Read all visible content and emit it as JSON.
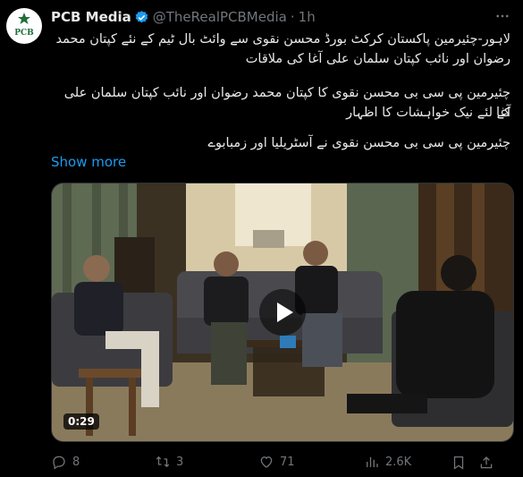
{
  "tweet": {
    "display_name": "PCB Media",
    "handle": "@TheRealPCBMedia",
    "separator": "·",
    "time": "1h",
    "avatar_text": "PCB",
    "more_icon": "more-dots-icon",
    "text_lines": [
      "لاہور-چئیرمین پاکستان کرکٹ بورڈ محسن نقوی سے وائٹ بال ٹیم کے نئے کپتان محمد",
      "رضوان اور نائب کپتان سلمان علی آغا کی ملاقات",
      "چئیرمین پی سی بی محسن نقوی کا کپتان محمد رضوان اور نائب کپتان سلمان علی آغا",
      "کے لئے نیک خواہشات کا اظہار",
      "چئیرمین پی سی بی محسن نقوی نے آسٹریلیا اور زمبابوے"
    ],
    "show_more": "Show more",
    "video_duration": "0:29"
  },
  "actions": {
    "replies": "8",
    "reposts": "3",
    "likes": "71",
    "views": "2.6K"
  },
  "colors": {
    "background": "#000000",
    "text": "#e7e9ea",
    "muted": "#71767b",
    "accent": "#1d9bf0"
  }
}
